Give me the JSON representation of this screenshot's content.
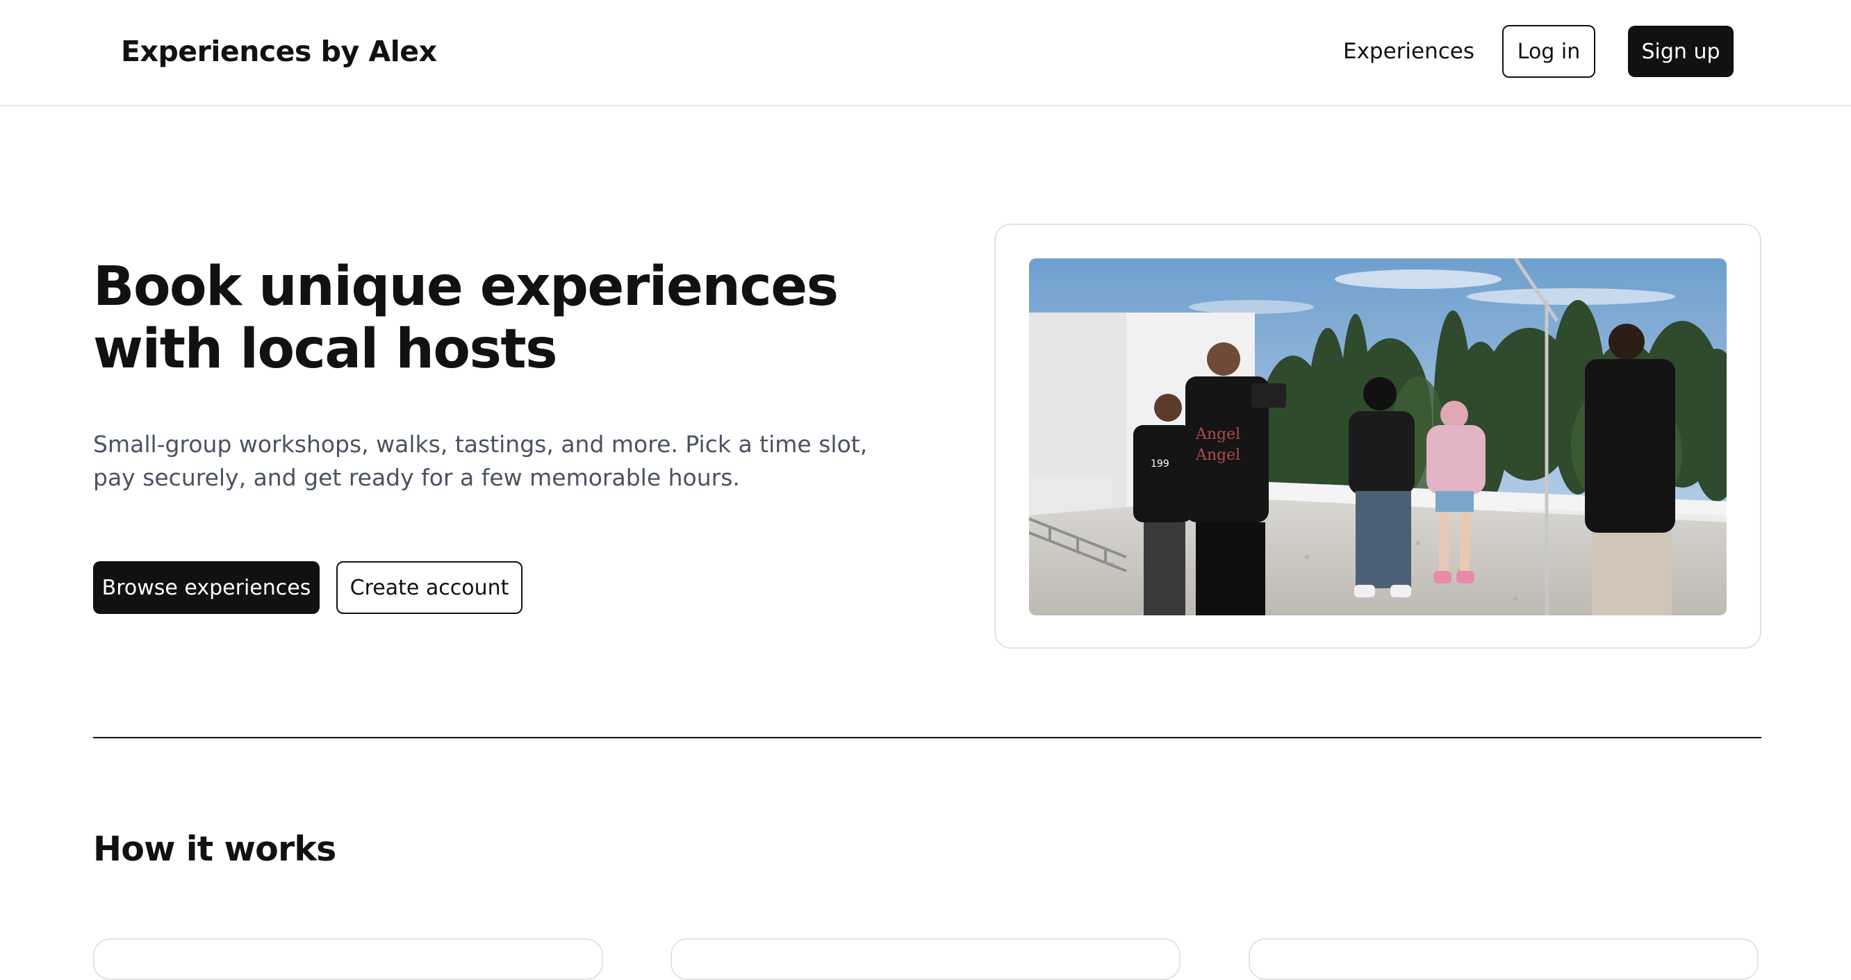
{
  "header": {
    "brand": "Experiences by Alex",
    "nav_experiences": "Experiences",
    "login_label": "Log in",
    "signup_label": "Sign up"
  },
  "hero": {
    "title": "Book unique experiences with local hosts",
    "subtitle": "Small-group workshops, walks, tastings, and more. Pick a time slot, pay securely, and get ready for a few memorable hours.",
    "browse_label": "Browse experiences",
    "create_label": "Create account",
    "shirt_text": "Angel"
  },
  "how_it_works": {
    "title": "How it works"
  },
  "colors": {
    "primary": "#111111",
    "muted_text": "#4a5260",
    "border": "#e3e3e3",
    "background": "#ffffff"
  }
}
